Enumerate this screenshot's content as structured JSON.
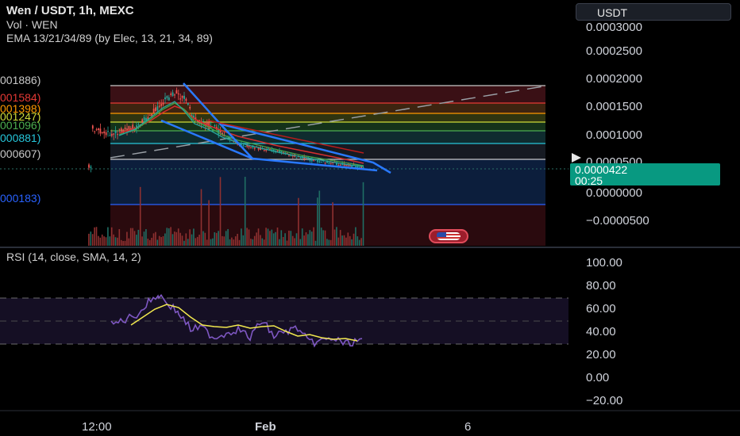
{
  "header": {
    "title": "Wen / USDT, 1h, MEXC",
    "volume_label": "Vol · WEN",
    "ema_label": "EMA 13/21/34/89 (by Elec, 13, 21, 34, 89)"
  },
  "currency_button": "USDT",
  "price_axis": {
    "ticks": [
      "0.0003000",
      "0.0002500",
      "0.0002000",
      "0.0001500",
      "0.0001000",
      "0.0000500",
      "0.0000000",
      "−0.0000500"
    ]
  },
  "last_price": {
    "value": "0.0000422",
    "countdown": "00:25",
    "color": "#089981"
  },
  "fib_levels": [
    {
      "label": "001886)",
      "color": "#c8c8c8"
    },
    {
      "label": "001584)",
      "color": "#e53935"
    },
    {
      "label": "001398)",
      "color": "#ff9800"
    },
    {
      "label": "001247)",
      "color": "#cddc39"
    },
    {
      "label": "001096)",
      "color": "#4caf50"
    },
    {
      "label": "000881)",
      "color": "#26c6da"
    },
    {
      "label": "000607)",
      "color": "#c8c8c8"
    },
    {
      "label": "000183)",
      "color": "#2962ff"
    }
  ],
  "rsi": {
    "label": "RSI (14, close, SMA, 14, 2)",
    "ticks": [
      "100.00",
      "80.00",
      "60.00",
      "40.00",
      "20.00",
      "0.00",
      "−20.00"
    ]
  },
  "time_axis": {
    "ticks": [
      "12:00",
      "Feb",
      "6"
    ]
  },
  "icons": {
    "flag": "us-flag-icon",
    "arrow": "price-arrow-icon"
  }
}
